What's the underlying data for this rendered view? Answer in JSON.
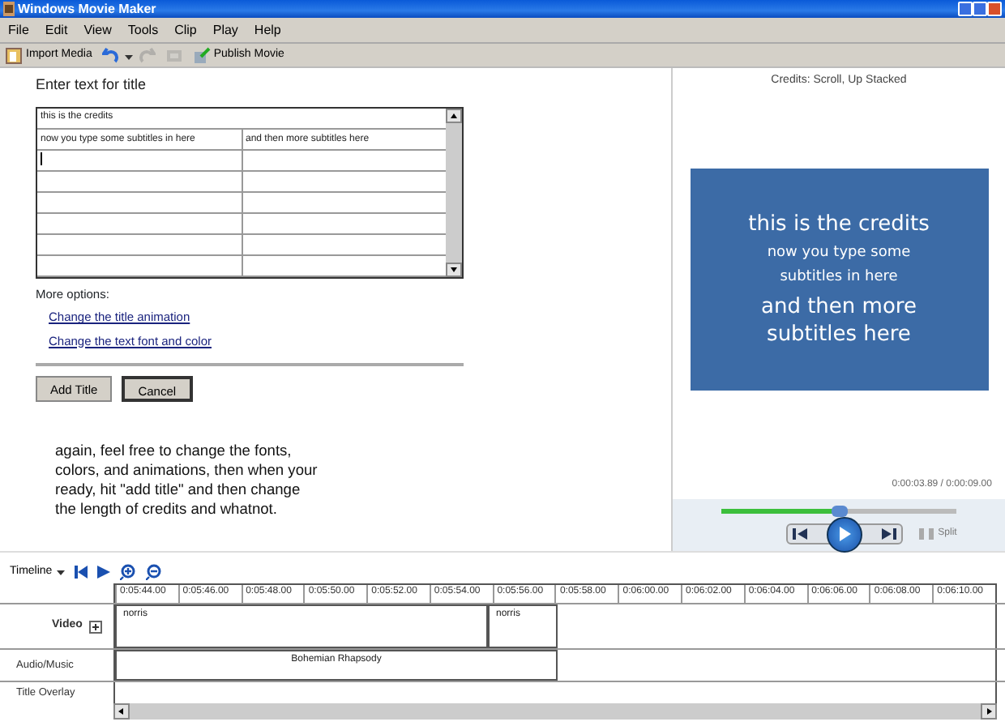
{
  "window": {
    "title": "Windows Movie Maker"
  },
  "menu": [
    "File",
    "Edit",
    "View",
    "Tools",
    "Clip",
    "Play",
    "Help"
  ],
  "toolbar": [
    {
      "kind": "import",
      "label": "Import Media",
      "disabled": false
    },
    {
      "kind": "undo",
      "disabled": false
    },
    {
      "kind": "redo",
      "disabled": true
    },
    {
      "kind": "automovie",
      "disabled": true
    },
    {
      "kind": "publish",
      "label": "Publish Movie",
      "disabled": false
    }
  ],
  "title_editor": {
    "heading": "Enter text for title",
    "grid_rows": [
      {
        "cells": [
          "this is the credits"
        ]
      },
      {
        "cells": [
          "now you type some subtitles in here",
          "and then more subtitles here"
        ]
      },
      {
        "cells": [
          "",
          ""
        ],
        "cursor": true
      },
      {
        "cells": [
          "",
          ""
        ]
      },
      {
        "cells": [
          "",
          ""
        ]
      },
      {
        "cells": [
          "",
          ""
        ]
      },
      {
        "cells": [
          "",
          ""
        ]
      },
      {
        "cells": [
          "",
          ""
        ]
      }
    ],
    "more_options": "More options:",
    "links": [
      "Change the title animation",
      "Change the text font and color"
    ],
    "buttons": [
      {
        "label": "Add Title",
        "selected": false
      },
      {
        "label": "Cancel",
        "selected": true
      }
    ],
    "hint": "again, feel free to change the fonts,\ncolors, and animations, then when your\nready, hit \"add title\" and then change\nthe length of credits and whatnot."
  },
  "preview": {
    "title": "Credits: Scroll, Up Stacked",
    "slide": [
      {
        "kind": "title",
        "text": "this is the credits"
      },
      {
        "kind": "subtitle",
        "text": "now you type some subtitles in here"
      },
      {
        "kind": "title",
        "text": "and then more subtitles here"
      }
    ],
    "time": "0:00:03.89 / 0:00:09.00",
    "level": 0.5,
    "split": "Split"
  },
  "timeline": {
    "label": "Timeline",
    "ruler": [
      "0:05:44.00",
      "0:05:46.00",
      "0:05:48.00",
      "0:05:50.00",
      "0:05:52.00",
      "0:05:54.00",
      "0:05:56.00",
      "0:05:58.00",
      "0:06:00.00",
      "0:06:02.00",
      "0:06:04.00",
      "0:06:06.00",
      "0:06:08.00",
      "0:06:10.00"
    ],
    "tracks": [
      {
        "name": "Video",
        "expand": true,
        "clips": [
          "norris",
          "norris"
        ]
      },
      {
        "name": "Audio/Music",
        "expand": false,
        "clips": [
          "Bohemian Rhapsody"
        ]
      },
      {
        "name": "Title Overlay",
        "expand": false
      }
    ]
  }
}
